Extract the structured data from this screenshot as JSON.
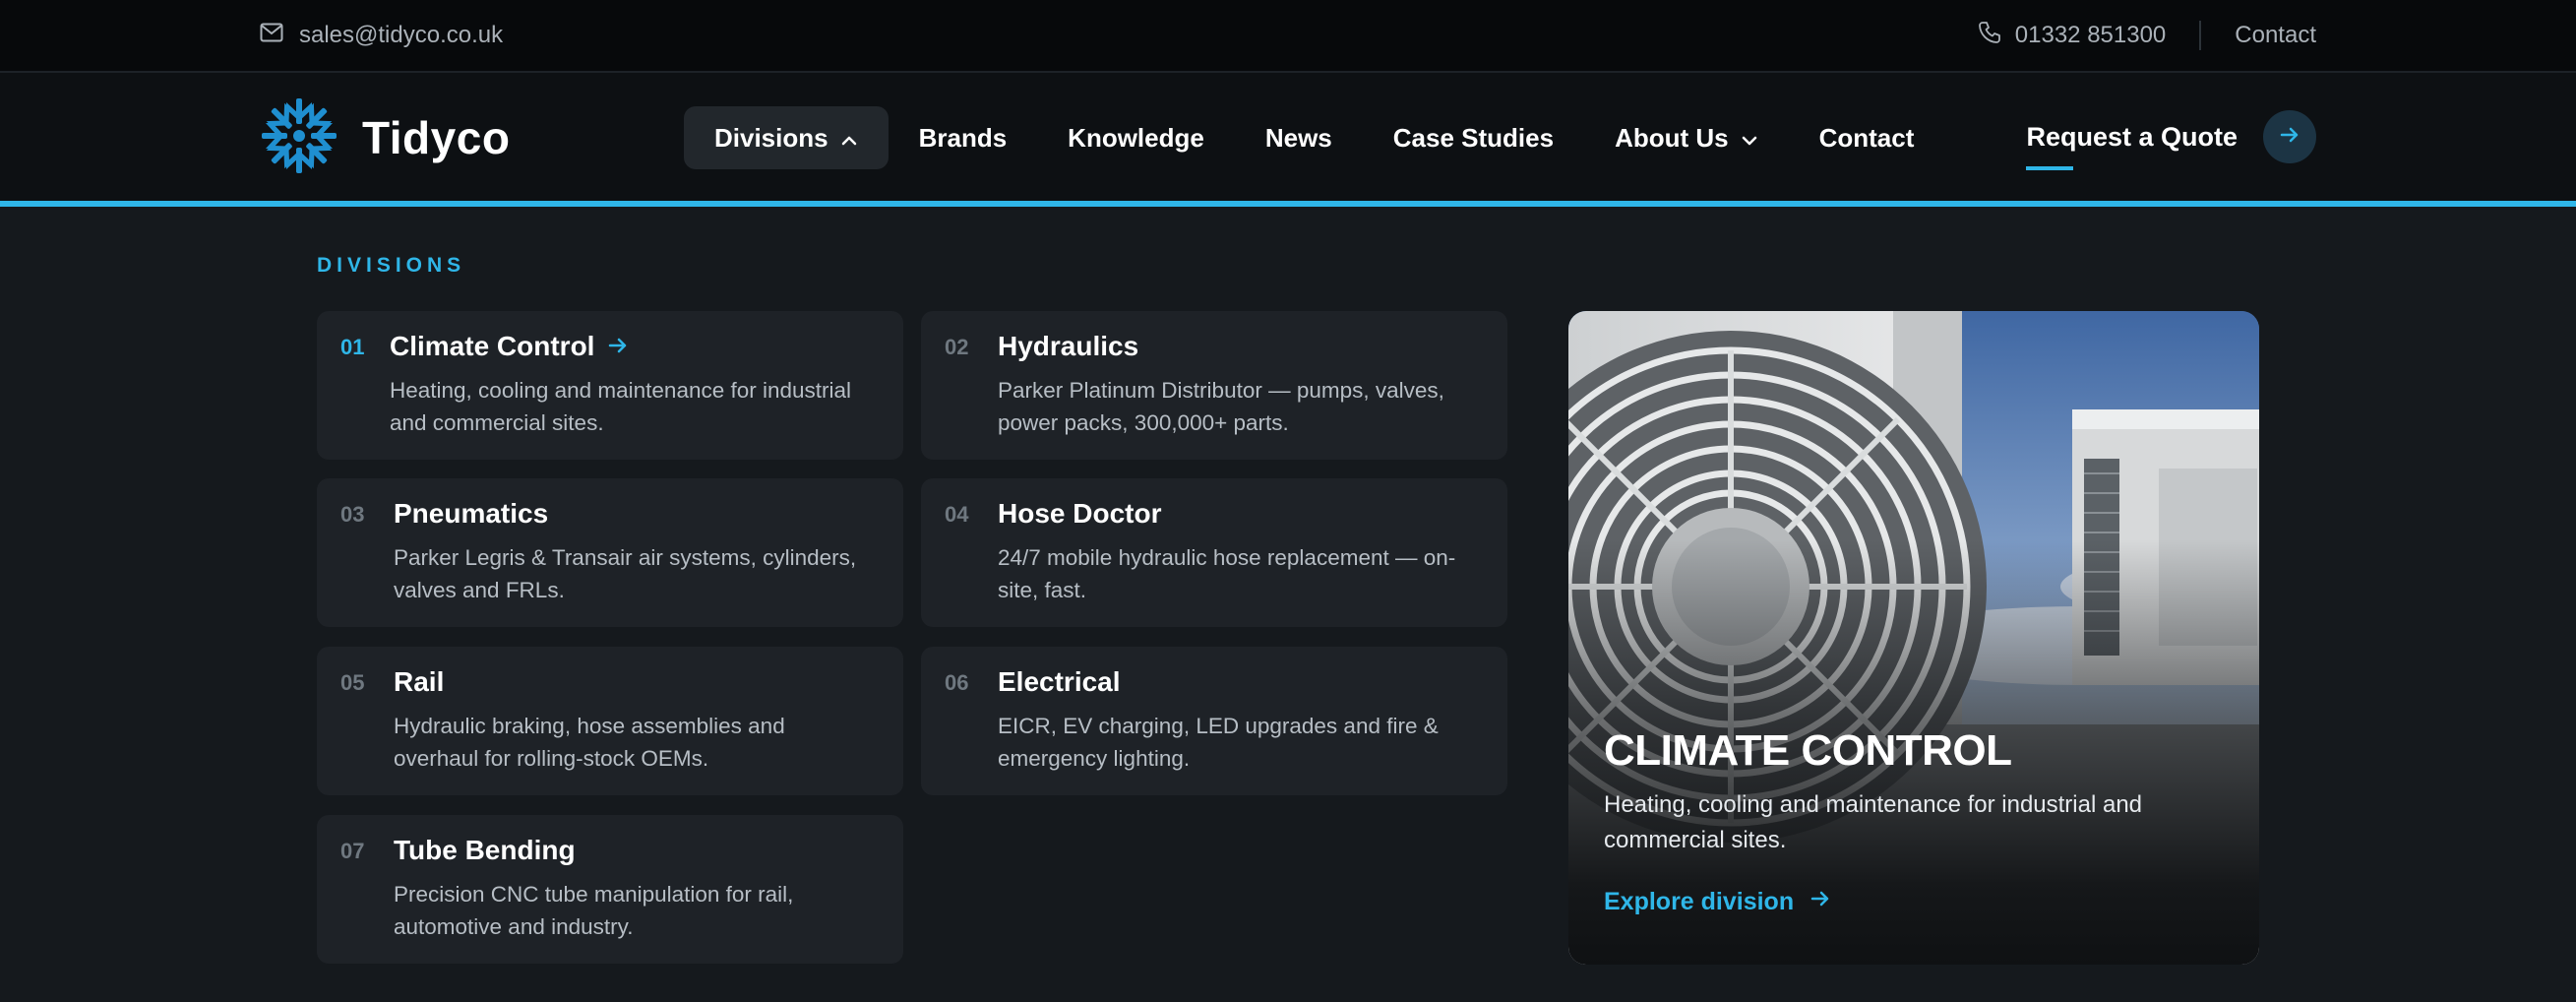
{
  "topbar": {
    "email": "sales@tidyco.co.uk",
    "phone": "01332 851300",
    "contact": "Contact",
    "icons": {
      "email": "mail-icon",
      "phone": "phone-icon"
    }
  },
  "brand": {
    "name": "Tidyco",
    "accent_color": "#2fb6e8",
    "logo_color": "#1f8fd0"
  },
  "nav": {
    "items": [
      {
        "label": "Divisions",
        "has_dropdown": true,
        "expanded": true
      },
      {
        "label": "Brands"
      },
      {
        "label": "Knowledge"
      },
      {
        "label": "News"
      },
      {
        "label": "Case Studies"
      },
      {
        "label": "About Us",
        "has_dropdown": true,
        "expanded": false
      },
      {
        "label": "Contact"
      }
    ],
    "cta": "Request a Quote"
  },
  "menu": {
    "section_label": "DIVISIONS",
    "divisions": [
      {
        "num": "01",
        "title": "Climate Control",
        "desc": "Heating, cooling and maintenance for industrial and commercial sites.",
        "active": true
      },
      {
        "num": "02",
        "title": "Hydraulics",
        "desc": "Parker Platinum Distributor — pumps, valves, power packs, 300,000+ parts."
      },
      {
        "num": "03",
        "title": "Pneumatics",
        "desc": "Parker Legris & Transair air systems, cylinders, valves and FRLs."
      },
      {
        "num": "04",
        "title": "Hose Doctor",
        "desc": "24/7 mobile hydraulic hose replacement — on-site, fast."
      },
      {
        "num": "05",
        "title": "Rail",
        "desc": "Hydraulic braking, hose assemblies and overhaul for rolling-stock OEMs."
      },
      {
        "num": "06",
        "title": "Electrical",
        "desc": "EICR, EV charging, LED upgrades and fire & emergency lighting."
      },
      {
        "num": "07",
        "title": "Tube Bending",
        "desc": "Precision CNC tube manipulation for rail, automotive and industry."
      }
    ],
    "feature": {
      "title": "CLIMATE CONTROL",
      "desc": "Heating, cooling and maintenance for industrial and commercial sites.",
      "link": "Explore division"
    }
  }
}
